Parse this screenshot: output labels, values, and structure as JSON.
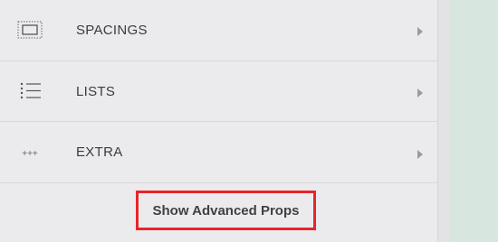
{
  "sections": [
    {
      "label": "SPACINGS",
      "icon": "spacing-box-icon"
    },
    {
      "label": "LISTS",
      "icon": "list-icon"
    },
    {
      "label": "EXTRA",
      "icon": "more-dots-icon"
    }
  ],
  "footer": {
    "advanced_button_label": "Show Advanced Props"
  },
  "colors": {
    "panel_bg": "#ebebee",
    "page_bg": "#d7e7e0",
    "highlight_border": "#e8242b",
    "text": "#3a3a40"
  }
}
